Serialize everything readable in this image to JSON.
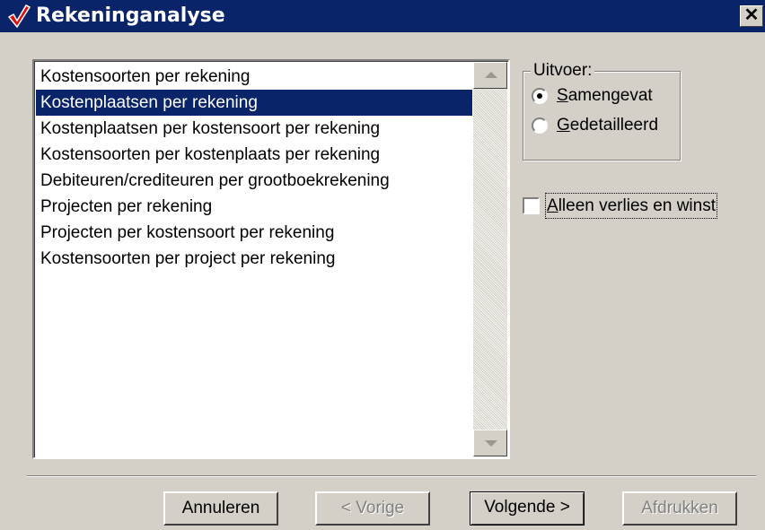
{
  "window": {
    "title": "Rekeninganalyse",
    "close_glyph": "✕"
  },
  "list": {
    "items": [
      {
        "label": "Kostensoorten per rekening",
        "selected": false
      },
      {
        "label": "Kostenplaatsen per rekening",
        "selected": true
      },
      {
        "label": "Kostenplaatsen per kostensoort per rekening",
        "selected": false
      },
      {
        "label": "Kostensoorten per kostenplaats per rekening",
        "selected": false
      },
      {
        "label": "Debiteuren/crediteuren per grootboekrekening",
        "selected": false
      },
      {
        "label": "Projecten per rekening",
        "selected": false
      },
      {
        "label": "Projecten per kostensoort per rekening",
        "selected": false
      },
      {
        "label": "Kostensoorten per project per rekening",
        "selected": false
      }
    ]
  },
  "output_group": {
    "legend": "Uitvoer:",
    "options": [
      {
        "label_first": "S",
        "label_rest": "amengevat",
        "checked": true
      },
      {
        "label_first": "G",
        "label_rest": "edetailleerd",
        "checked": false
      }
    ]
  },
  "options": {
    "loss_profit_only": {
      "label_first": "A",
      "label_rest": "lleen verlies en winst",
      "checked": false
    }
  },
  "buttons": {
    "cancel": "Annuleren",
    "previous": "< Vorige",
    "next": "Volgende >",
    "print": "Afdrukken"
  },
  "colors": {
    "titlebar": "#0a246a",
    "selection": "#0a246a",
    "face": "#d4d0c8",
    "check_icon": "#e01010"
  }
}
